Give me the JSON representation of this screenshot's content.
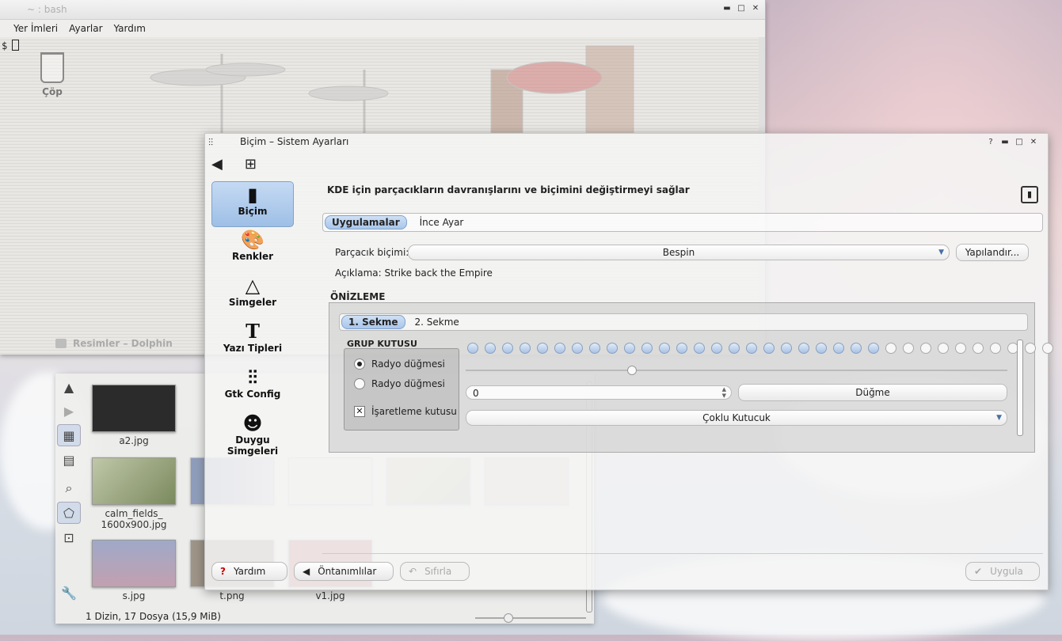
{
  "terminal": {
    "title": "~ : bash",
    "menu": [
      "Yer İmleri",
      "Ayarlar",
      "Yardım"
    ],
    "prompt": "$"
  },
  "desktop": {
    "trash_label": "Çöp"
  },
  "dolphin": {
    "title": "Resimler – Dolphin",
    "status": "1 Dizin, 17 Dosya (15,9 MiB)",
    "files": [
      {
        "name": "a2.jpg",
        "color": "#2b2b2b"
      },
      {
        "name": "calm_fields_\n1600x900.jpg",
        "color": "#8b9a6e"
      },
      {
        "name": "s.jpg",
        "color": "#b89ab4"
      },
      {
        "name": "t.png",
        "color": "#5a4a3a"
      },
      {
        "name": "v1.jpg",
        "color": "#a0302a"
      }
    ]
  },
  "dialog": {
    "title": "Biçim – Sistem Ayarları",
    "headline": "KDE için parçacıkların davranışlarını ve biçimini değiştirmeyi sağlar",
    "categories": [
      {
        "label": "Biçim",
        "icon": "tie-icon"
      },
      {
        "label": "Renkler",
        "icon": "palette-icon"
      },
      {
        "label": "Simgeler",
        "icon": "triangle-icon"
      },
      {
        "label": "Yazı Tipleri",
        "icon": "font-icon"
      },
      {
        "label": "Gtk Config",
        "icon": "sliders-icon"
      },
      {
        "label": "Duygu Simgeleri",
        "icon": "smiley-icon"
      }
    ],
    "tabs": [
      "Uygulamalar",
      "İnce Ayar"
    ],
    "widget_style_label": "Parçacık biçimi:",
    "widget_style_value": "Bespin",
    "configure_button": "Yapılandır...",
    "description": "Açıklama: Strike back the Empire",
    "preview_heading": "ÖNİZLEME",
    "preview": {
      "tabs": [
        "1. Sekme",
        "2. Sekme"
      ],
      "group_title": "GRUP KUTUSU",
      "radio1": "Radyo düğmesi",
      "radio2": "Radyo düğmesi",
      "checkbox": "İşaretleme kutusu",
      "spin_value": "0",
      "button": "Düğme",
      "combo": "Çoklu Kutucuk",
      "progress_filled": 24,
      "progress_total": 34
    },
    "buttons": {
      "help": "Yardım",
      "defaults": "Öntanımlılar",
      "reset": "Sıfırla",
      "apply": "Uygula"
    }
  }
}
